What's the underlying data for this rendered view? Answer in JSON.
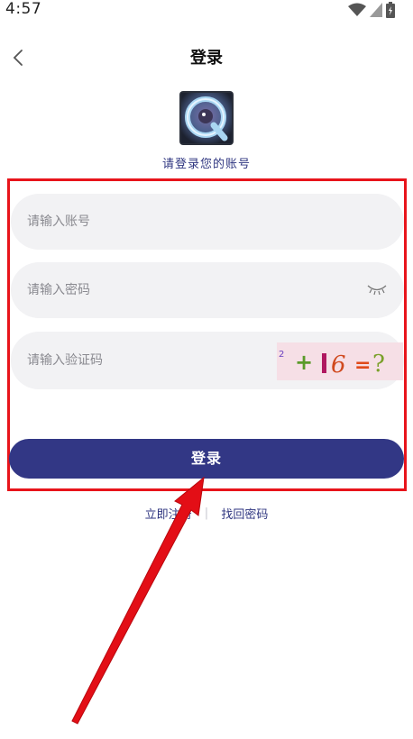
{
  "status_bar": {
    "time": "4:57"
  },
  "nav": {
    "title": "登录"
  },
  "subtitle": "请登录您的账号",
  "form": {
    "account": {
      "placeholder": "请输入账号",
      "value": ""
    },
    "password": {
      "placeholder": "请输入密码",
      "value": ""
    },
    "captcha": {
      "placeholder": "请输入验证码",
      "value": "",
      "image_text": "2 + 16 = ?"
    }
  },
  "login_button": "登录",
  "links": {
    "register": "立即注册",
    "separator": "|",
    "forgot": "找回密码"
  },
  "colors": {
    "primary": "#323785",
    "highlight_box": "#e8141b",
    "field_bg": "#f2f2f4"
  },
  "icons": {
    "back": "chevron-left-icon",
    "eye": "eye-closed-icon"
  }
}
